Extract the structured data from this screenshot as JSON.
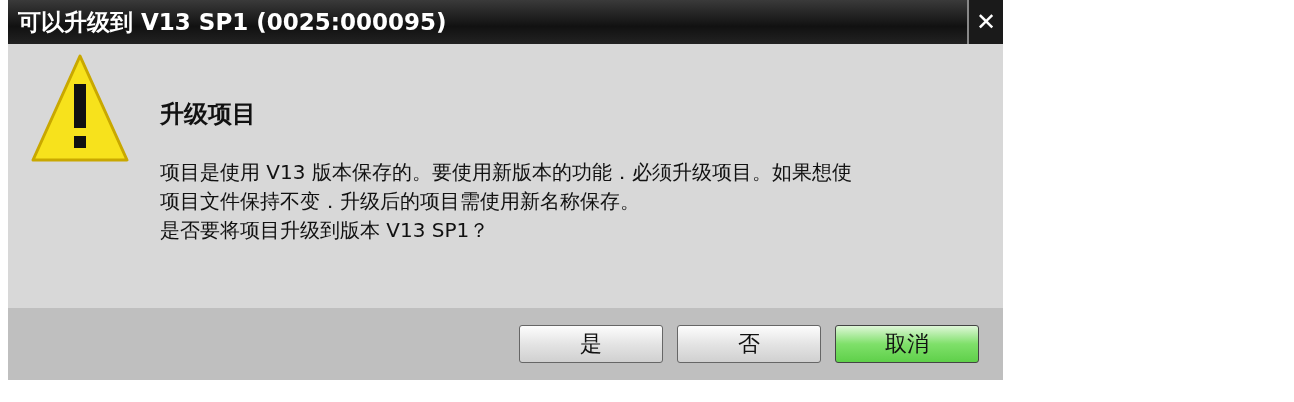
{
  "window": {
    "title": "可以升级到 V13 SP1 (0025:000095)",
    "close": "✕"
  },
  "heading": "升级项目",
  "message_lines": [
    "项目是使用 V13 版本保存的。要使用新版本的功能．必须升级项目。如果想使",
    "项目文件保持不变．升级后的项目需使用新名称保存。",
    "是否要将项目升级到版本 V13 SP1？"
  ],
  "buttons": [
    {
      "label": "是",
      "selected": false
    },
    {
      "label": "否",
      "selected": false
    },
    {
      "label": "取消",
      "selected": true
    }
  ]
}
